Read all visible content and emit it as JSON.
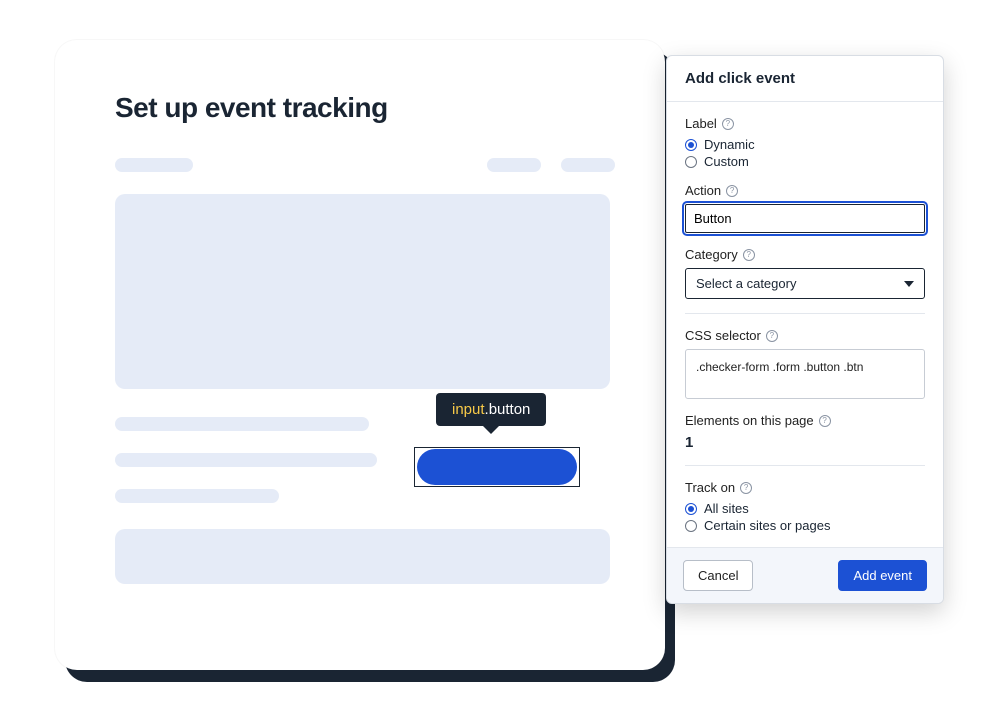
{
  "page": {
    "title": "Set up event tracking"
  },
  "tooltip": {
    "tag": "input",
    "class": ".button"
  },
  "panel": {
    "header": "Add click event",
    "label_section": {
      "label": "Label",
      "option_dynamic": "Dynamic",
      "option_custom": "Custom"
    },
    "action_section": {
      "label": "Action",
      "value": "Button"
    },
    "category_section": {
      "label": "Category",
      "placeholder": "Select a category"
    },
    "selector_section": {
      "label": "CSS selector",
      "value": ".checker-form  .form  .button  .btn"
    },
    "elements_section": {
      "label": "Elements on this page",
      "count": "1"
    },
    "track_section": {
      "label": "Track on",
      "option_all": "All sites",
      "option_certain": "Certain sites or pages"
    },
    "footer": {
      "cancel": "Cancel",
      "submit": "Add event"
    }
  }
}
